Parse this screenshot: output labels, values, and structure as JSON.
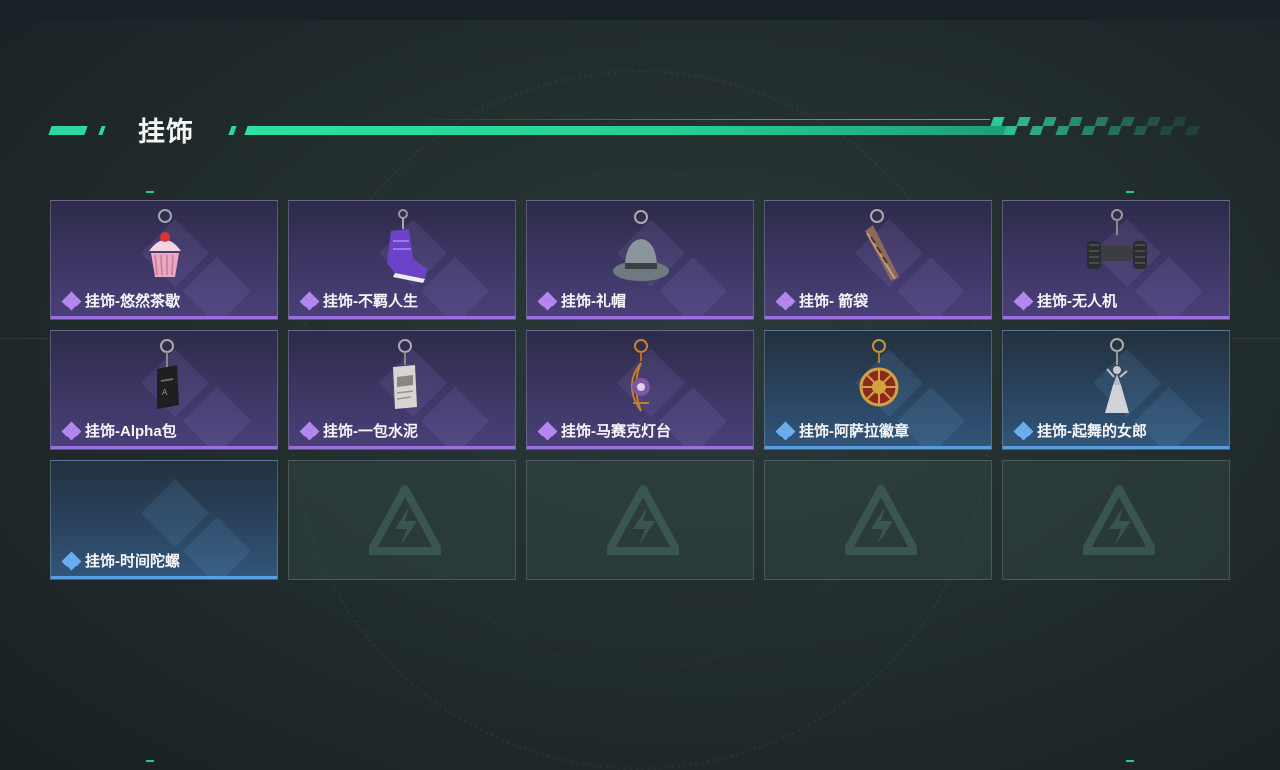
{
  "section": {
    "title": "挂饰"
  },
  "colors": {
    "accent": "#2ed79e",
    "rarity_purple": "#9a6fe0",
    "rarity_blue": "#5a9ee2"
  },
  "items": [
    {
      "label": "挂饰-悠然茶歇",
      "rarity": "purple",
      "icon": "cupcake-charm-icon"
    },
    {
      "label": "挂饰-不羁人生",
      "rarity": "purple",
      "icon": "sneaker-charm-icon"
    },
    {
      "label": "挂饰-礼帽",
      "rarity": "purple",
      "icon": "fedora-hat-charm-icon"
    },
    {
      "label": "挂饰- 箭袋",
      "rarity": "purple",
      "icon": "quiver-charm-icon"
    },
    {
      "label": "挂饰-无人机",
      "rarity": "purple",
      "icon": "drone-charm-icon"
    },
    {
      "label": "挂饰-Alpha包",
      "rarity": "purple",
      "icon": "alpha-bag-charm-icon"
    },
    {
      "label": "挂饰-一包水泥",
      "rarity": "purple",
      "icon": "cement-bag-charm-icon"
    },
    {
      "label": "挂饰-马赛克灯台",
      "rarity": "purple",
      "icon": "mosaic-lamp-charm-icon"
    },
    {
      "label": "挂饰-阿萨拉徽章",
      "rarity": "blue",
      "icon": "asala-badge-charm-icon"
    },
    {
      "label": "挂饰-起舞的女郎",
      "rarity": "blue",
      "icon": "dancing-lady-charm-icon"
    },
    {
      "label": "挂饰-时间陀螺",
      "rarity": "blue",
      "icon": ""
    },
    {
      "label": "",
      "rarity": "empty",
      "icon": "empty-slot-logo-icon"
    },
    {
      "label": "",
      "rarity": "empty",
      "icon": "empty-slot-logo-icon"
    },
    {
      "label": "",
      "rarity": "empty",
      "icon": "empty-slot-logo-icon"
    },
    {
      "label": "",
      "rarity": "empty",
      "icon": "empty-slot-logo-icon"
    }
  ]
}
